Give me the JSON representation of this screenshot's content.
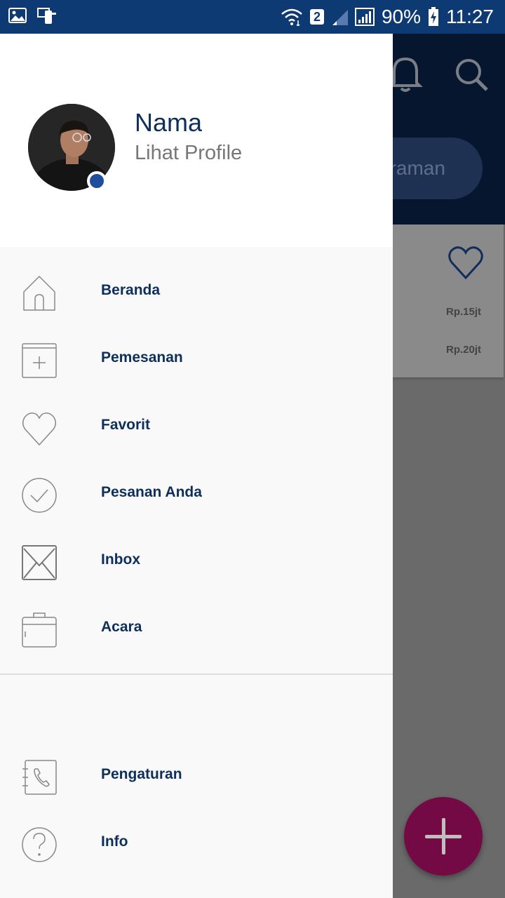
{
  "status_bar": {
    "sim_badge": "2",
    "battery": "90%",
    "time": "11:27"
  },
  "background": {
    "search_pill_text": "araman",
    "prices": [
      "Rp.15jt",
      "Rp.20jt"
    ]
  },
  "profile": {
    "name": "Nama",
    "link": "Lihat Profile"
  },
  "menu": {
    "items": [
      {
        "label": "Beranda",
        "icon": "home-icon"
      },
      {
        "label": "Pemesanan",
        "icon": "add-booking-icon"
      },
      {
        "label": "Favorit",
        "icon": "heart-icon"
      },
      {
        "label": "Pesanan Anda",
        "icon": "check-circle-icon"
      },
      {
        "label": "Inbox",
        "icon": "envelope-icon"
      },
      {
        "label": "Acara",
        "icon": "briefcase-icon"
      }
    ],
    "bottom_items": [
      {
        "label": "Pengaturan",
        "icon": "phone-book-icon"
      },
      {
        "label": "Info",
        "icon": "question-icon"
      }
    ]
  },
  "colors": {
    "status_bar": "#0e3a73",
    "header_dark": "#06162f",
    "menu_text": "#0e2f5c",
    "fab": "#730a45",
    "online_dot": "#1e4f9c"
  }
}
